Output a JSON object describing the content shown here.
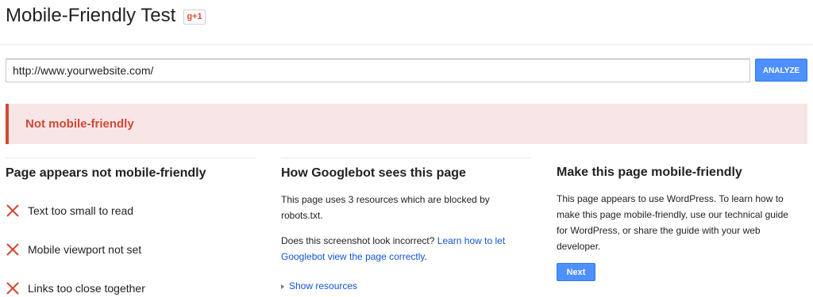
{
  "header": {
    "title": "Mobile-Friendly Test",
    "gplus_label": "g+1"
  },
  "search": {
    "url_value": "http://www.yourwebsite.com/",
    "analyze_label": "ANALYZE"
  },
  "alert": {
    "text": "Not mobile-friendly",
    "color": "#d14836",
    "background": "#f8e6e6"
  },
  "col1": {
    "heading": "Page appears not mobile-friendly",
    "issues": [
      "Text too small to read",
      "Mobile viewport not set",
      "Links too close together"
    ]
  },
  "col2": {
    "heading": "How Googlebot sees this page",
    "p1_line1": "This page uses 3 resources which are blocked by",
    "p1_line2": "robots.txt.",
    "p2_text": "Does this screenshot look incorrect?",
    "p2_link_part1": "Learn how to let",
    "p2_link_part2": "Googlebot view the page correctly",
    "p2_period": ".",
    "show_resources": "Show resources"
  },
  "col3": {
    "heading": "Make this page mobile-friendly",
    "p_line1": "This page appears to use WordPress. To learn how to",
    "p_line2": "make this page mobile-friendly, use our technical guide",
    "p_line3": "for WordPress, or share the guide with your web",
    "p_line4": "developer.",
    "next_label": "Next"
  },
  "accent": "#4d90fe"
}
